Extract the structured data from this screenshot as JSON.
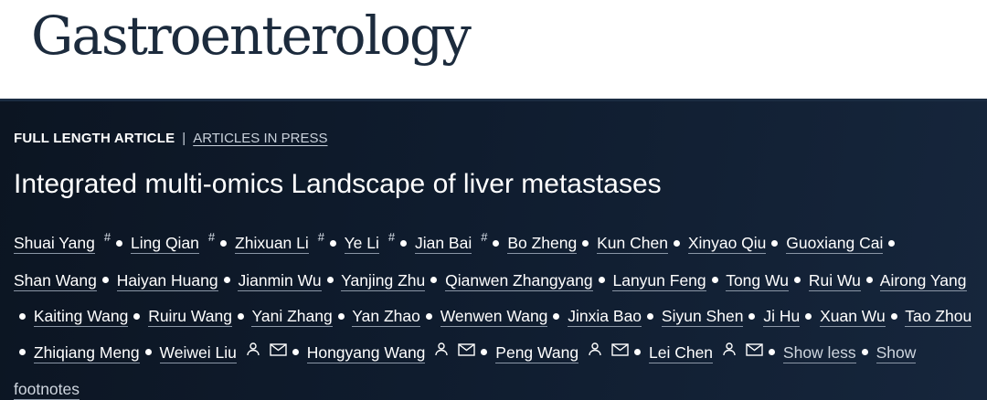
{
  "journal": {
    "title": "Gastroenterology"
  },
  "article": {
    "type": "FULL LENGTH ARTICLE",
    "separator": "|",
    "status": "ARTICLES IN PRESS",
    "title": "Integrated multi-omics Landscape of liver metastases"
  },
  "authors": [
    {
      "name": "Shuai Yang",
      "sup": "#"
    },
    {
      "name": "Ling Qian",
      "sup": "#"
    },
    {
      "name": "Zhixuan Li",
      "sup": "#"
    },
    {
      "name": "Ye Li",
      "sup": "#"
    },
    {
      "name": "Jian Bai",
      "sup": "#"
    },
    {
      "name": "Bo Zheng"
    },
    {
      "name": "Kun Chen"
    },
    {
      "name": "Xinyao Qiu"
    },
    {
      "name": "Guoxiang Cai"
    },
    {
      "name": "Shan Wang"
    },
    {
      "name": "Haiyan Huang"
    },
    {
      "name": "Jianmin Wu"
    },
    {
      "name": "Yanjing Zhu"
    },
    {
      "name": "Qianwen Zhangyang"
    },
    {
      "name": "Lanyun Feng"
    },
    {
      "name": "Tong Wu"
    },
    {
      "name": "Rui Wu"
    },
    {
      "name": "Airong Yang"
    },
    {
      "name": "Kaiting Wang"
    },
    {
      "name": "Ruiru Wang"
    },
    {
      "name": "Yani Zhang"
    },
    {
      "name": "Yan Zhao"
    },
    {
      "name": "Wenwen Wang"
    },
    {
      "name": "Jinxia Bao"
    },
    {
      "name": "Siyun Shen"
    },
    {
      "name": "Ji Hu"
    },
    {
      "name": "Xuan Wu"
    },
    {
      "name": "Tao Zhou"
    },
    {
      "name": "Zhiqiang Meng"
    },
    {
      "name": "Weiwei Liu",
      "icons": [
        "person-icon",
        "mail-icon"
      ]
    },
    {
      "name": "Hongyang Wang",
      "icons": [
        "person-icon",
        "mail-icon"
      ]
    },
    {
      "name": "Peng Wang",
      "icons": [
        "person-icon",
        "mail-icon"
      ]
    },
    {
      "name": "Lei Chen",
      "icons": [
        "person-icon",
        "mail-icon"
      ]
    }
  ],
  "links": {
    "show_less": "Show less",
    "show_footnotes": "Show footnotes"
  }
}
